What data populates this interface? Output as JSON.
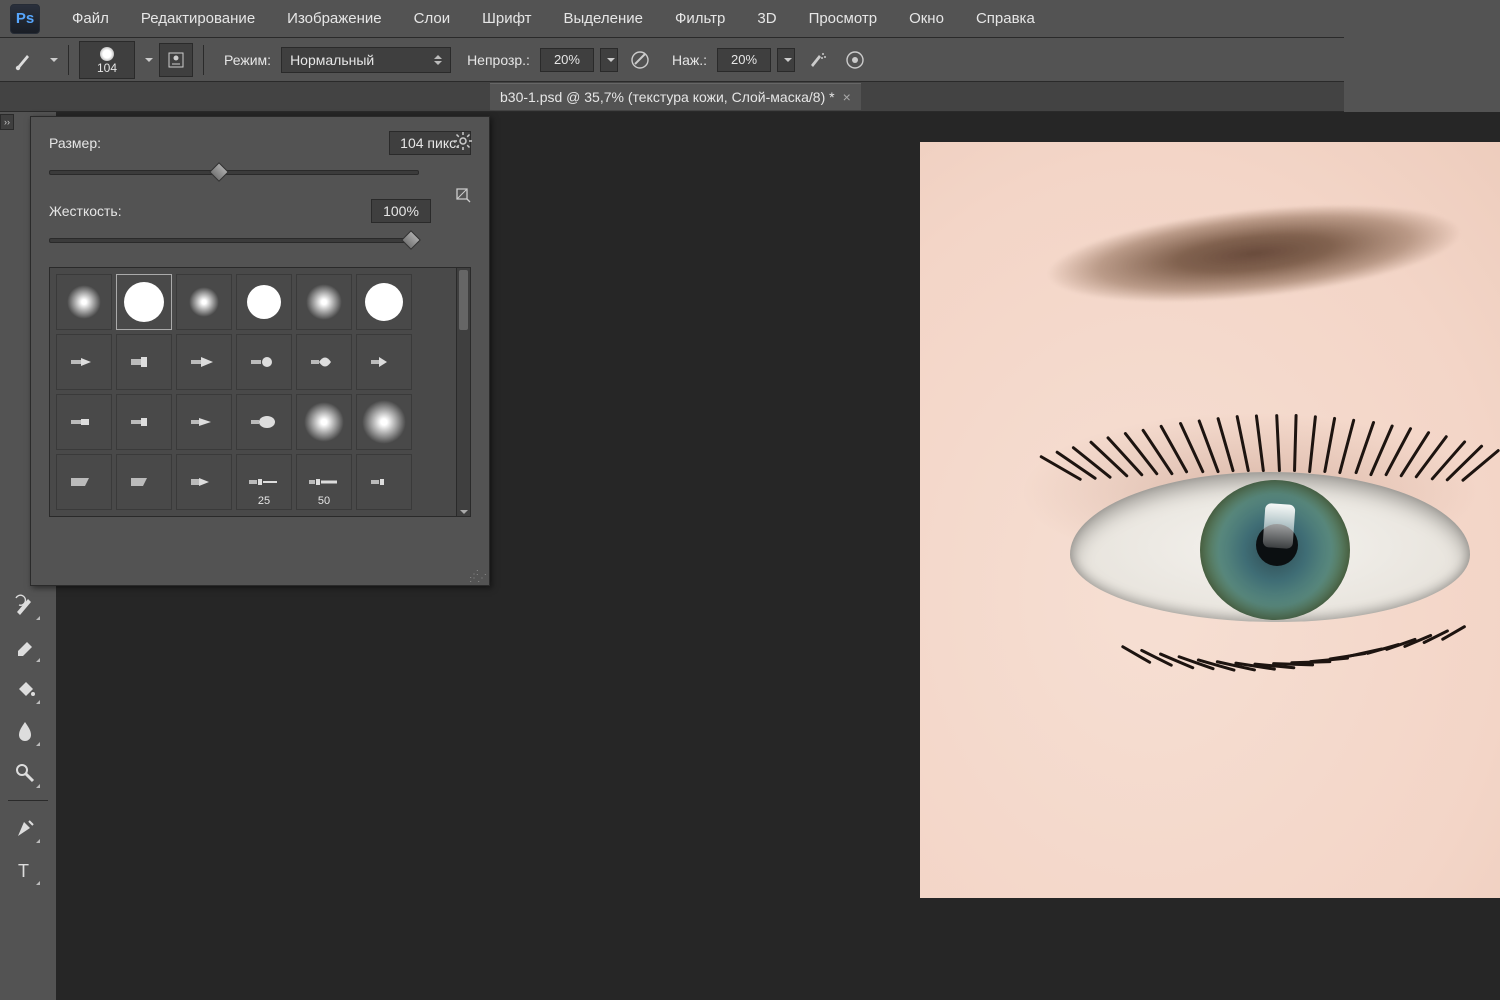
{
  "app": {
    "name": "Ps"
  },
  "menu": [
    "Файл",
    "Редактирование",
    "Изображение",
    "Слои",
    "Шрифт",
    "Выделение",
    "Фильтр",
    "3D",
    "Просмотр",
    "Окно",
    "Справка"
  ],
  "options": {
    "brush_size_preview": "104",
    "mode_label": "Режим:",
    "mode_value": "Нормальный",
    "opacity_label": "Непрозр.:",
    "opacity_value": "20%",
    "flow_label": "Наж.:",
    "flow_value": "20%"
  },
  "tab": {
    "title": "b30-1.psd @ 35,7% (текстура кожи, Слой-маска/8) *"
  },
  "brush_popup": {
    "size_label": "Размер:",
    "size_value": "104 пикс.",
    "hardness_label": "Жесткость:",
    "hardness_value": "100%",
    "preset_labels": [
      "25",
      "50"
    ]
  },
  "tools": [
    "history-brush",
    "eraser",
    "paint-bucket",
    "blur",
    "dodge",
    "pen",
    "type"
  ]
}
